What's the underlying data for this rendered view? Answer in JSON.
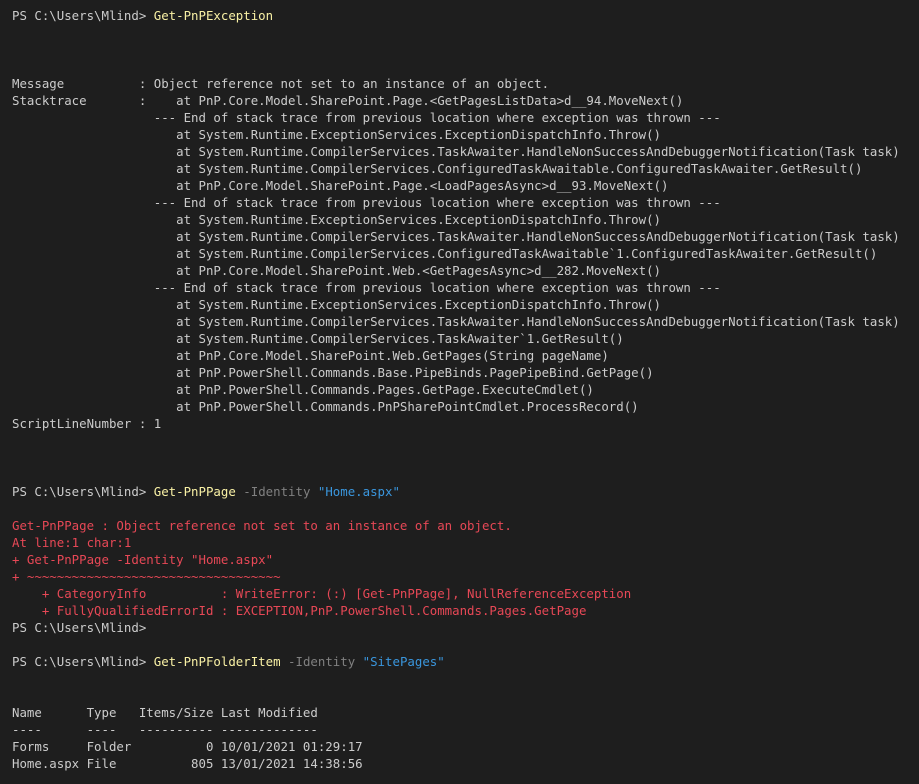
{
  "terminal": {
    "lines": [
      [
        {
          "t": "PS C:\\Users\\Mlind> ",
          "c": "plain"
        },
        {
          "t": "Get-PnPException",
          "c": "cmd"
        }
      ],
      [],
      [],
      [],
      [
        {
          "t": "Message          : Object reference not set to an instance of an object.",
          "c": "plain"
        }
      ],
      [
        {
          "t": "Stacktrace       :    at PnP.Core.Model.SharePoint.Page.<GetPagesListData>d__94.MoveNext()",
          "c": "plain"
        }
      ],
      [
        {
          "t": "                   --- End of stack trace from previous location where exception was thrown ---",
          "c": "plain"
        }
      ],
      [
        {
          "t": "                      at System.Runtime.ExceptionServices.ExceptionDispatchInfo.Throw()",
          "c": "plain"
        }
      ],
      [
        {
          "t": "                      at System.Runtime.CompilerServices.TaskAwaiter.HandleNonSuccessAndDebuggerNotification(Task task)",
          "c": "plain"
        }
      ],
      [
        {
          "t": "                      at System.Runtime.CompilerServices.ConfiguredTaskAwaitable.ConfiguredTaskAwaiter.GetResult()",
          "c": "plain"
        }
      ],
      [
        {
          "t": "                      at PnP.Core.Model.SharePoint.Page.<LoadPagesAsync>d__93.MoveNext()",
          "c": "plain"
        }
      ],
      [
        {
          "t": "                   --- End of stack trace from previous location where exception was thrown ---",
          "c": "plain"
        }
      ],
      [
        {
          "t": "                      at System.Runtime.ExceptionServices.ExceptionDispatchInfo.Throw()",
          "c": "plain"
        }
      ],
      [
        {
          "t": "                      at System.Runtime.CompilerServices.TaskAwaiter.HandleNonSuccessAndDebuggerNotification(Task task)",
          "c": "plain"
        }
      ],
      [
        {
          "t": "                      at System.Runtime.CompilerServices.ConfiguredTaskAwaitable`1.ConfiguredTaskAwaiter.GetResult()",
          "c": "plain"
        }
      ],
      [
        {
          "t": "                      at PnP.Core.Model.SharePoint.Web.<GetPagesAsync>d__282.MoveNext()",
          "c": "plain"
        }
      ],
      [
        {
          "t": "                   --- End of stack trace from previous location where exception was thrown ---",
          "c": "plain"
        }
      ],
      [
        {
          "t": "                      at System.Runtime.ExceptionServices.ExceptionDispatchInfo.Throw()",
          "c": "plain"
        }
      ],
      [
        {
          "t": "                      at System.Runtime.CompilerServices.TaskAwaiter.HandleNonSuccessAndDebuggerNotification(Task task)",
          "c": "plain"
        }
      ],
      [
        {
          "t": "                      at System.Runtime.CompilerServices.TaskAwaiter`1.GetResult()",
          "c": "plain"
        }
      ],
      [
        {
          "t": "                      at PnP.Core.Model.SharePoint.Web.GetPages(String pageName)",
          "c": "plain"
        }
      ],
      [
        {
          "t": "                      at PnP.PowerShell.Commands.Base.PipeBinds.PagePipeBind.GetPage()",
          "c": "plain"
        }
      ],
      [
        {
          "t": "                      at PnP.PowerShell.Commands.Pages.GetPage.ExecuteCmdlet()",
          "c": "plain"
        }
      ],
      [
        {
          "t": "                      at PnP.PowerShell.Commands.PnPSharePointCmdlet.ProcessRecord()",
          "c": "plain"
        }
      ],
      [
        {
          "t": "ScriptLineNumber : 1",
          "c": "plain"
        }
      ],
      [],
      [],
      [],
      [
        {
          "t": "PS C:\\Users\\Mlind> ",
          "c": "plain"
        },
        {
          "t": "Get-PnPPage",
          "c": "cmd"
        },
        {
          "t": " -Identity ",
          "c": "param"
        },
        {
          "t": "\"Home.aspx\"",
          "c": "str"
        }
      ],
      [],
      [
        {
          "t": "Get-PnPPage : Object reference not set to an instance of an object.",
          "c": "err"
        }
      ],
      [
        {
          "t": "At line:1 char:1",
          "c": "err"
        }
      ],
      [
        {
          "t": "+ Get-PnPPage -Identity \"Home.aspx\"",
          "c": "err"
        }
      ],
      [
        {
          "t": "+ ~~~~~~~~~~~~~~~~~~~~~~~~~~~~~~~~~~",
          "c": "err"
        }
      ],
      [
        {
          "t": "    + CategoryInfo          : WriteError: (:) [Get-PnPPage], NullReferenceException",
          "c": "err"
        }
      ],
      [
        {
          "t": "    + FullyQualifiedErrorId : EXCEPTION,PnP.PowerShell.Commands.Pages.GetPage",
          "c": "err"
        }
      ],
      [
        {
          "t": "PS C:\\Users\\Mlind>",
          "c": "plain"
        }
      ],
      [],
      [
        {
          "t": "PS C:\\Users\\Mlind> ",
          "c": "plain"
        },
        {
          "t": "Get-PnPFolderItem",
          "c": "cmd"
        },
        {
          "t": " -Identity ",
          "c": "param"
        },
        {
          "t": "\"SitePages\"",
          "c": "str"
        }
      ],
      [],
      [],
      [
        {
          "t": "Name      Type   Items/Size Last Modified",
          "c": "plain"
        }
      ],
      [
        {
          "t": "----      ----   ---------- -------------",
          "c": "plain"
        }
      ],
      [
        {
          "t": "Forms     Folder          0 10/01/2021 01:29:17",
          "c": "plain"
        }
      ],
      [
        {
          "t": "Home.aspx File          805 13/01/2021 14:38:56",
          "c": "plain"
        }
      ]
    ]
  },
  "colors": {
    "background": "#1e1e1e",
    "text": "#cccccc",
    "cmdlet": "#f9f1a5",
    "parameter": "#808080",
    "string": "#3a96dd",
    "error": "#e74856"
  }
}
